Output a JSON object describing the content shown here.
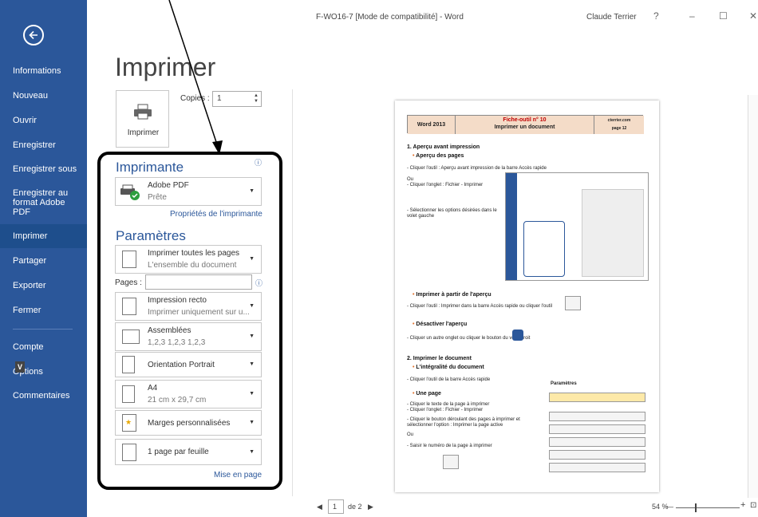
{
  "window": {
    "title": "F-WO16-7 [Mode de compatibilité] - Word",
    "user": "Claude Terrier",
    "help": "?",
    "minimize": "–",
    "maximize": "☐",
    "close": "✕"
  },
  "sidebar": {
    "back_icon": "back-arrow-icon",
    "items": [
      {
        "label": "Informations"
      },
      {
        "label": "Nouveau"
      },
      {
        "label": "Ouvrir"
      },
      {
        "label": "Enregistrer"
      },
      {
        "label": "Enregistrer sous"
      },
      {
        "label": "Enregistrer au format Adobe PDF"
      },
      {
        "label": "Imprimer"
      },
      {
        "label": "Partager"
      },
      {
        "label": "Exporter"
      },
      {
        "label": "Fermer"
      },
      {
        "label": "Compte"
      },
      {
        "label": "Options"
      },
      {
        "label": "Commentaires"
      }
    ],
    "active": "Imprimer",
    "keytip": "V",
    "colors": {
      "bg": "#2b579a",
      "active_bg": "#1e4e8c"
    }
  },
  "print": {
    "title": "Imprimer",
    "print_button": "Imprimer",
    "copies_label": "Copies :",
    "copies_value": "1",
    "printer_section": "Imprimante",
    "printer_name": "Adobe PDF",
    "printer_status": "Prête",
    "printer_properties": "Propriétés de l'imprimante",
    "settings_section": "Paramètres",
    "pages_label": "Pages :",
    "pages_value": "",
    "settings": [
      {
        "line1": "Imprimer toutes les pages",
        "line2": "L'ensemble du document"
      },
      {
        "line1": "Impression recto",
        "line2": "Imprimer uniquement sur u..."
      },
      {
        "line1": "Assemblées",
        "line2": "1,2,3    1,2,3    1,2,3"
      },
      {
        "line1": "Orientation Portrait",
        "line2": ""
      },
      {
        "line1": "A4",
        "line2": "21 cm x 29,7 cm"
      },
      {
        "line1": "Marges personnalisées",
        "line2": ""
      },
      {
        "line1": "1 page par feuille",
        "line2": ""
      }
    ],
    "page_setup_link": "Mise en page"
  },
  "preview": {
    "header": {
      "left": "Word 2013",
      "center_1": "Fiche-outil n° 10",
      "center_2": "Imprimer un document",
      "right_1": "cterrier.com",
      "right_2": "page 12"
    },
    "s1_title": "1. Aperçu avant impression",
    "s1_b1": "Aperçu des pages",
    "s1_t1": "- Cliquer l'outil : Aperçu avant impression   de la barre Accès rapide",
    "s1_t2": "Ou",
    "s1_t3": "- Cliquer l'onglet : Fichier - Imprimer",
    "s1_t4": "- Sélectionner les options désirées dans le",
    "s1_t5": "volet gauche",
    "s1_b2": "Imprimer à partir de l'aperçu",
    "s1_t6": "- Cliquer l'outil : Imprimer    dans la barre Accès rapide ou cliquer l'outil",
    "s1_b3": "Désactiver l'aperçu",
    "s1_t7": "- Cliquer un autre onglet ou cliquer le bouton        du volet droit",
    "s2_title": "2. Imprimer le document",
    "s2_b1": "L'intégralité du document",
    "s2_t1": "- Cliquer l'outil    de la barre Accès rapide",
    "s2_b2": "Une page",
    "s2_t2": "- Cliquer le texte de la page à imprimer",
    "s2_t3": "- Cliquer l'onglet : Fichier - Imprimer",
    "s2_t4": "- Cliquer le bouton déroulant des pages à imprimer et",
    "s2_t5": "sélectionner l'option : Imprimer la page active",
    "s2_t6": "Ou",
    "s2_t7": "- Saisir le numéro de la page à imprimer",
    "s2_param": "Paramètres"
  },
  "footer": {
    "page_current": "1",
    "page_total": "de 2",
    "zoom": "54 %",
    "zoom_minus": "—",
    "zoom_plus": "+"
  },
  "annotation": {
    "arrow": "black-arrow",
    "frame": "black-rounded-frame"
  }
}
